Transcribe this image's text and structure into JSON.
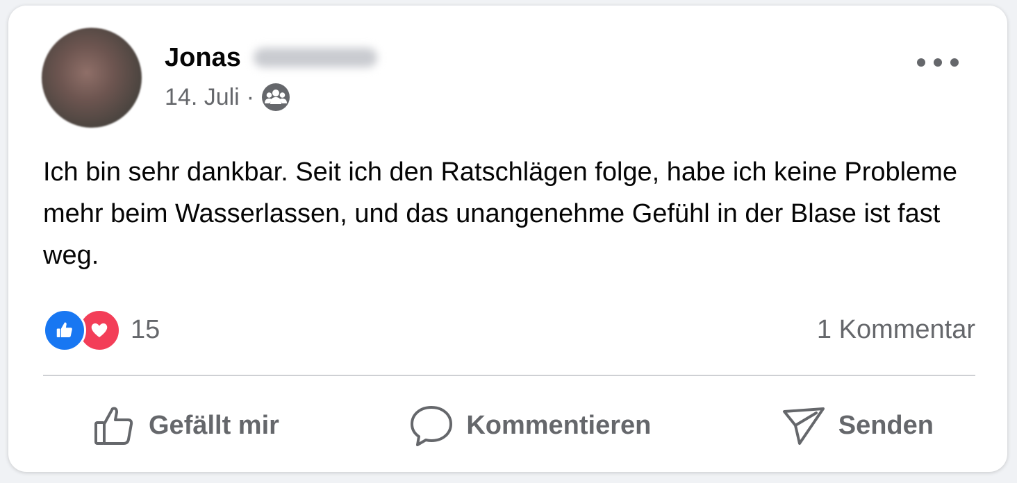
{
  "post": {
    "author_first_name": "Jonas",
    "date": "14. Juli",
    "separator": "·",
    "audience_icon": "friends-group-icon",
    "text": "Ich bin sehr dankbar. Seit ich den Ratschlägen folge, habe ich keine Probleme mehr beim Wasserlassen, und das unangenehme Gefühl in der Blase ist fast weg."
  },
  "reactions": {
    "types": [
      "like",
      "love"
    ],
    "count": "15",
    "comments": "1 Kommentar"
  },
  "actions": {
    "like_label": "Gefällt mir",
    "comment_label": "Kommentieren",
    "send_label": "Senden"
  },
  "colors": {
    "like_blue": "#1877f2",
    "love_red": "#f33e58",
    "secondary_text": "#65676b"
  }
}
